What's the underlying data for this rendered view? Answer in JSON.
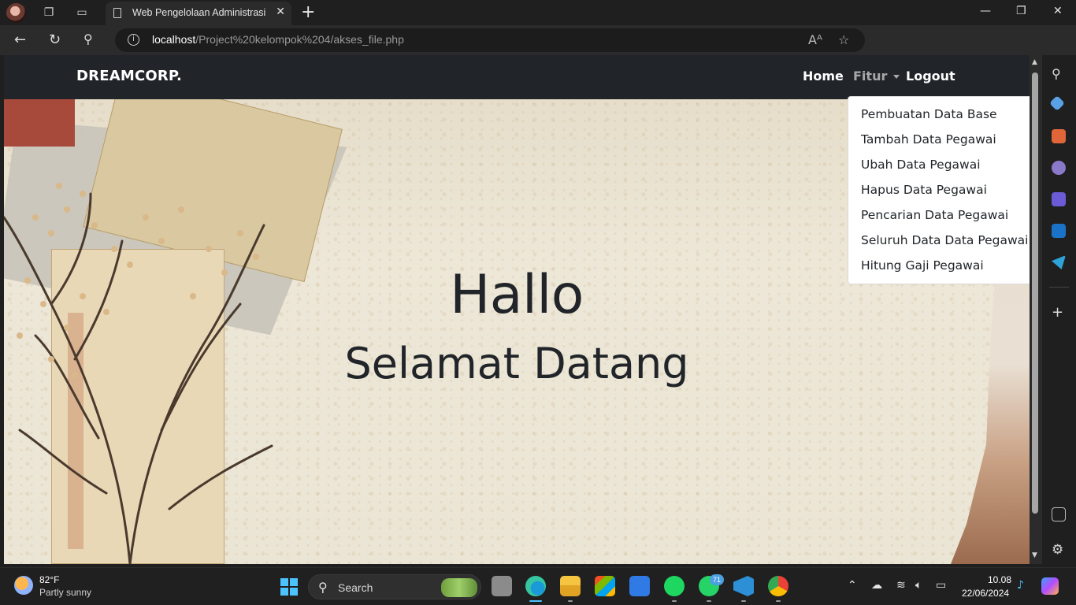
{
  "browser": {
    "tab_title": "Web Pengelolaan Administrasi Pegawai",
    "url_host": "localhost",
    "url_path": "/Project%20kelompok%204/akses_file.php"
  },
  "navbar": {
    "brand": "DREAMCORP.",
    "links": [
      "Home",
      "Fitur",
      "Logout"
    ]
  },
  "dropdown": {
    "items": [
      "Pembuatan Data Base",
      "Tambah Data Pegawai",
      "Ubah Data Pegawai",
      "Hapus Data Pegawai",
      "Pencarian Data Pegawai",
      "Seluruh Data Data Pegawai",
      "Hitung Gaji Pegawai"
    ]
  },
  "hero": {
    "greeting": "Hallo",
    "subtitle": "Selamat Datang"
  },
  "taskbar": {
    "weather_temp": "82°F",
    "weather_desc": "Partly sunny",
    "search_label": "Search",
    "whatsapp_badge": "71",
    "time": "10.08",
    "date": "22/06/2024"
  },
  "colors": {
    "navbar_bg": "#212529",
    "accent_blue": "#4cc2ff"
  }
}
